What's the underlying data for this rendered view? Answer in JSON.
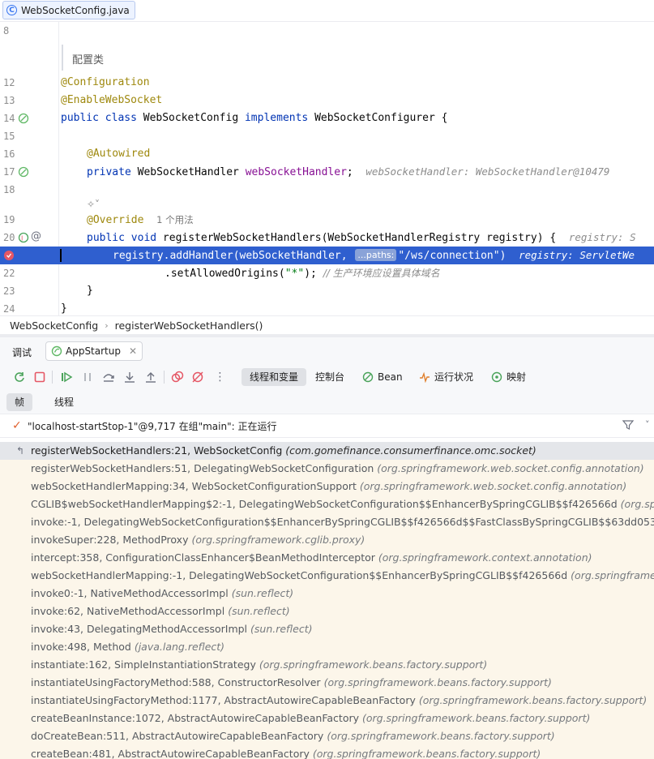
{
  "file_tab": {
    "label": "WebSocketConfig.java"
  },
  "editor": {
    "doc_comment": "配置类",
    "lines": [
      {
        "num": "8"
      },
      {
        "num": "12",
        "annotation": "@Configuration"
      },
      {
        "num": "13",
        "annotation": "@EnableWebSocket"
      },
      {
        "num": "14",
        "kw1": "public class ",
        "plain1": "WebSocketConfig ",
        "kw2": "implements ",
        "plain2": "WebSocketConfigurer {"
      },
      {
        "num": "15"
      },
      {
        "num": "16",
        "annotation": "@Autowired"
      },
      {
        "num": "17",
        "kw1": "private ",
        "plain1": "WebSocketHandler ",
        "field": "webSocketHandler",
        "plain2": ";",
        "hint": "webSocketHandler: WebSocketHandler@10479"
      },
      {
        "num": "18"
      },
      {
        "num": "19",
        "annotation": "@Override",
        "usage": "1 个用法"
      },
      {
        "num": "20",
        "kw1": "public void ",
        "plain1": "registerWebSocketHandlers(WebSocketHandlerRegistry registry) {",
        "hint": "registry: S"
      },
      {
        "num": "21",
        "plain1": "registry.addHandler(webSocketHandler, ",
        "param_hint": "...paths:",
        "string": "\"/ws/connection\"",
        "plain2": ")",
        "hint": "registry: ServletWe"
      },
      {
        "num": "22",
        "plain1": ".setAllowedOrigins(",
        "string": "\"*\"",
        "plain2": "); ",
        "comment": "// 生产环境应设置具体域名"
      },
      {
        "num": "23",
        "plain1": "}"
      },
      {
        "num": "24",
        "plain1": "}"
      }
    ]
  },
  "breadcrumb": {
    "items": [
      "WebSocketConfig",
      "registerWebSocketHandlers()"
    ]
  },
  "debug": {
    "title": "调试",
    "session_tab": "AppStartup",
    "tabs": {
      "threads_vars": "线程和变量",
      "console": "控制台",
      "bean": "Bean",
      "runtime": "运行状况",
      "mapping": "映射"
    },
    "subtabs": {
      "frames": "帧",
      "threads": "线程"
    },
    "thread_status": "\"localhost-startStop-1\"@9,717 在组\"main\": 正在运行",
    "frames": [
      {
        "method": "registerWebSocketHandlers:21, WebSocketConfig",
        "pkg": "(com.gomefinance.consumerfinance.omc.socket)"
      },
      {
        "method": "registerWebSocketHandlers:51, DelegatingWebSocketConfiguration",
        "pkg": "(org.springframework.web.socket.config.annotation)"
      },
      {
        "method": "webSocketHandlerMapping:34, WebSocketConfigurationSupport",
        "pkg": "(org.springframework.web.socket.config.annotation)"
      },
      {
        "method": "CGLIB$webSocketHandlerMapping$2:-1, DelegatingWebSocketConfiguration$$EnhancerBySpringCGLIB$$f426566d",
        "pkg": "(org.springframew"
      },
      {
        "method": "invoke:-1, DelegatingWebSocketConfiguration$$EnhancerBySpringCGLIB$$f426566d$$FastClassBySpringCGLIB$$63dd053c",
        "pkg": "(org.spring"
      },
      {
        "method": "invokeSuper:228, MethodProxy",
        "pkg": "(org.springframework.cglib.proxy)"
      },
      {
        "method": "intercept:358, ConfigurationClassEnhancer$BeanMethodInterceptor",
        "pkg": "(org.springframework.context.annotation)"
      },
      {
        "method": "webSocketHandlerMapping:-1, DelegatingWebSocketConfiguration$$EnhancerBySpringCGLIB$$f426566d",
        "pkg": "(org.springframework.web"
      },
      {
        "method": "invoke0:-1, NativeMethodAccessorImpl",
        "pkg": "(sun.reflect)"
      },
      {
        "method": "invoke:62, NativeMethodAccessorImpl",
        "pkg": "(sun.reflect)"
      },
      {
        "method": "invoke:43, DelegatingMethodAccessorImpl",
        "pkg": "(sun.reflect)"
      },
      {
        "method": "invoke:498, Method",
        "pkg": "(java.lang.reflect)"
      },
      {
        "method": "instantiate:162, SimpleInstantiationStrategy",
        "pkg": "(org.springframework.beans.factory.support)"
      },
      {
        "method": "instantiateUsingFactoryMethod:588, ConstructorResolver",
        "pkg": "(org.springframework.beans.factory.support)"
      },
      {
        "method": "instantiateUsingFactoryMethod:1177, AbstractAutowireCapableBeanFactory",
        "pkg": "(org.springframework.beans.factory.support)"
      },
      {
        "method": "createBeanInstance:1072, AbstractAutowireCapableBeanFactory",
        "pkg": "(org.springframework.beans.factory.support)"
      },
      {
        "method": "doCreateBean:511, AbstractAutowireCapableBeanFactory",
        "pkg": "(org.springframework.beans.factory.support)"
      },
      {
        "method": "createBean:481, AbstractAutowireCapableBeanFactory",
        "pkg": "(org.springframework.beans.factory.support)"
      }
    ]
  },
  "colors": {
    "accent": "#3574f0",
    "selection": "#2f5fcf",
    "keyword": "#0033b3",
    "annotation": "#9e880d",
    "field": "#871094",
    "string": "#067d17",
    "breakpoint": "#e55765"
  }
}
